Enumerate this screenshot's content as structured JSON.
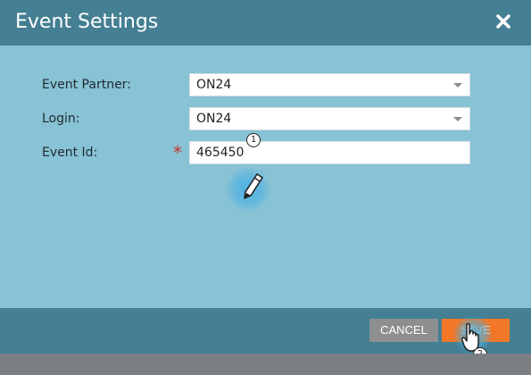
{
  "dialog": {
    "title": "Event Settings",
    "close_icon": "close-icon"
  },
  "form": {
    "event_partner": {
      "label": "Event Partner:",
      "value": "ON24"
    },
    "login": {
      "label": "Login:",
      "value": "ON24"
    },
    "event_id": {
      "label": "Event Id:",
      "value": "465450",
      "required_mark": "*"
    }
  },
  "footer": {
    "cancel_label": "CANCEL",
    "save_label": "SAVE"
  },
  "annotations": {
    "step1": "1",
    "step2": "2",
    "step1_icon": "pencil-cursor-icon",
    "step2_icon": "hand-pointer-icon"
  },
  "colors": {
    "header_bg": "#447f93",
    "body_bg": "#88c2d5",
    "save_bg": "#f27726",
    "cancel_bg": "#8d8f91",
    "required": "#c0392b"
  }
}
